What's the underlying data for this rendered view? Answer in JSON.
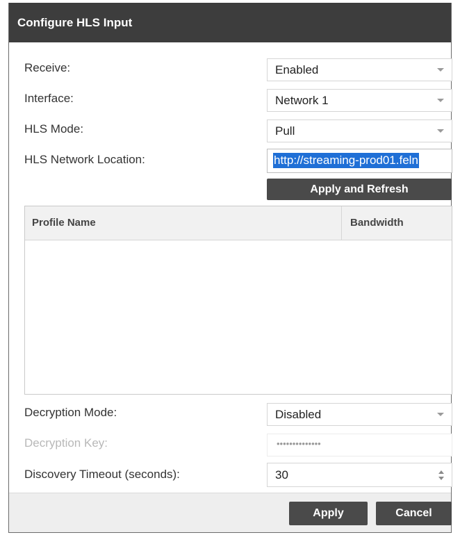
{
  "dialog": {
    "title": "Configure HLS Input"
  },
  "fields": {
    "receive": {
      "label": "Receive:",
      "value": "Enabled"
    },
    "interface": {
      "label": "Interface:",
      "value": "Network 1"
    },
    "hls_mode": {
      "label": "HLS Mode:",
      "value": "Pull"
    },
    "hls_network_location": {
      "label": "HLS Network Location:",
      "value": "http://streaming-prod01.feln"
    },
    "decryption_mode": {
      "label": "Decryption Mode:",
      "value": "Disabled"
    },
    "decryption_key": {
      "label": "Decryption Key:",
      "masked_value": "••••••••••••••"
    },
    "discovery_timeout": {
      "label": "Discovery Timeout (seconds):",
      "value": "30"
    }
  },
  "apply_refresh_label": "Apply and Refresh",
  "profiles_table": {
    "columns": [
      "Profile Name",
      "Bandwidth"
    ],
    "rows": []
  },
  "footer": {
    "apply_label": "Apply",
    "cancel_label": "Cancel"
  },
  "colors": {
    "titlebar": "#3d3d3d",
    "button": "#4a4a4a",
    "selection": "#1f6fd6",
    "disabled_text": "#b8b8b8"
  },
  "icons": [
    "dropdown-caret-icon",
    "spinner-up-icon",
    "spinner-down-icon"
  ]
}
